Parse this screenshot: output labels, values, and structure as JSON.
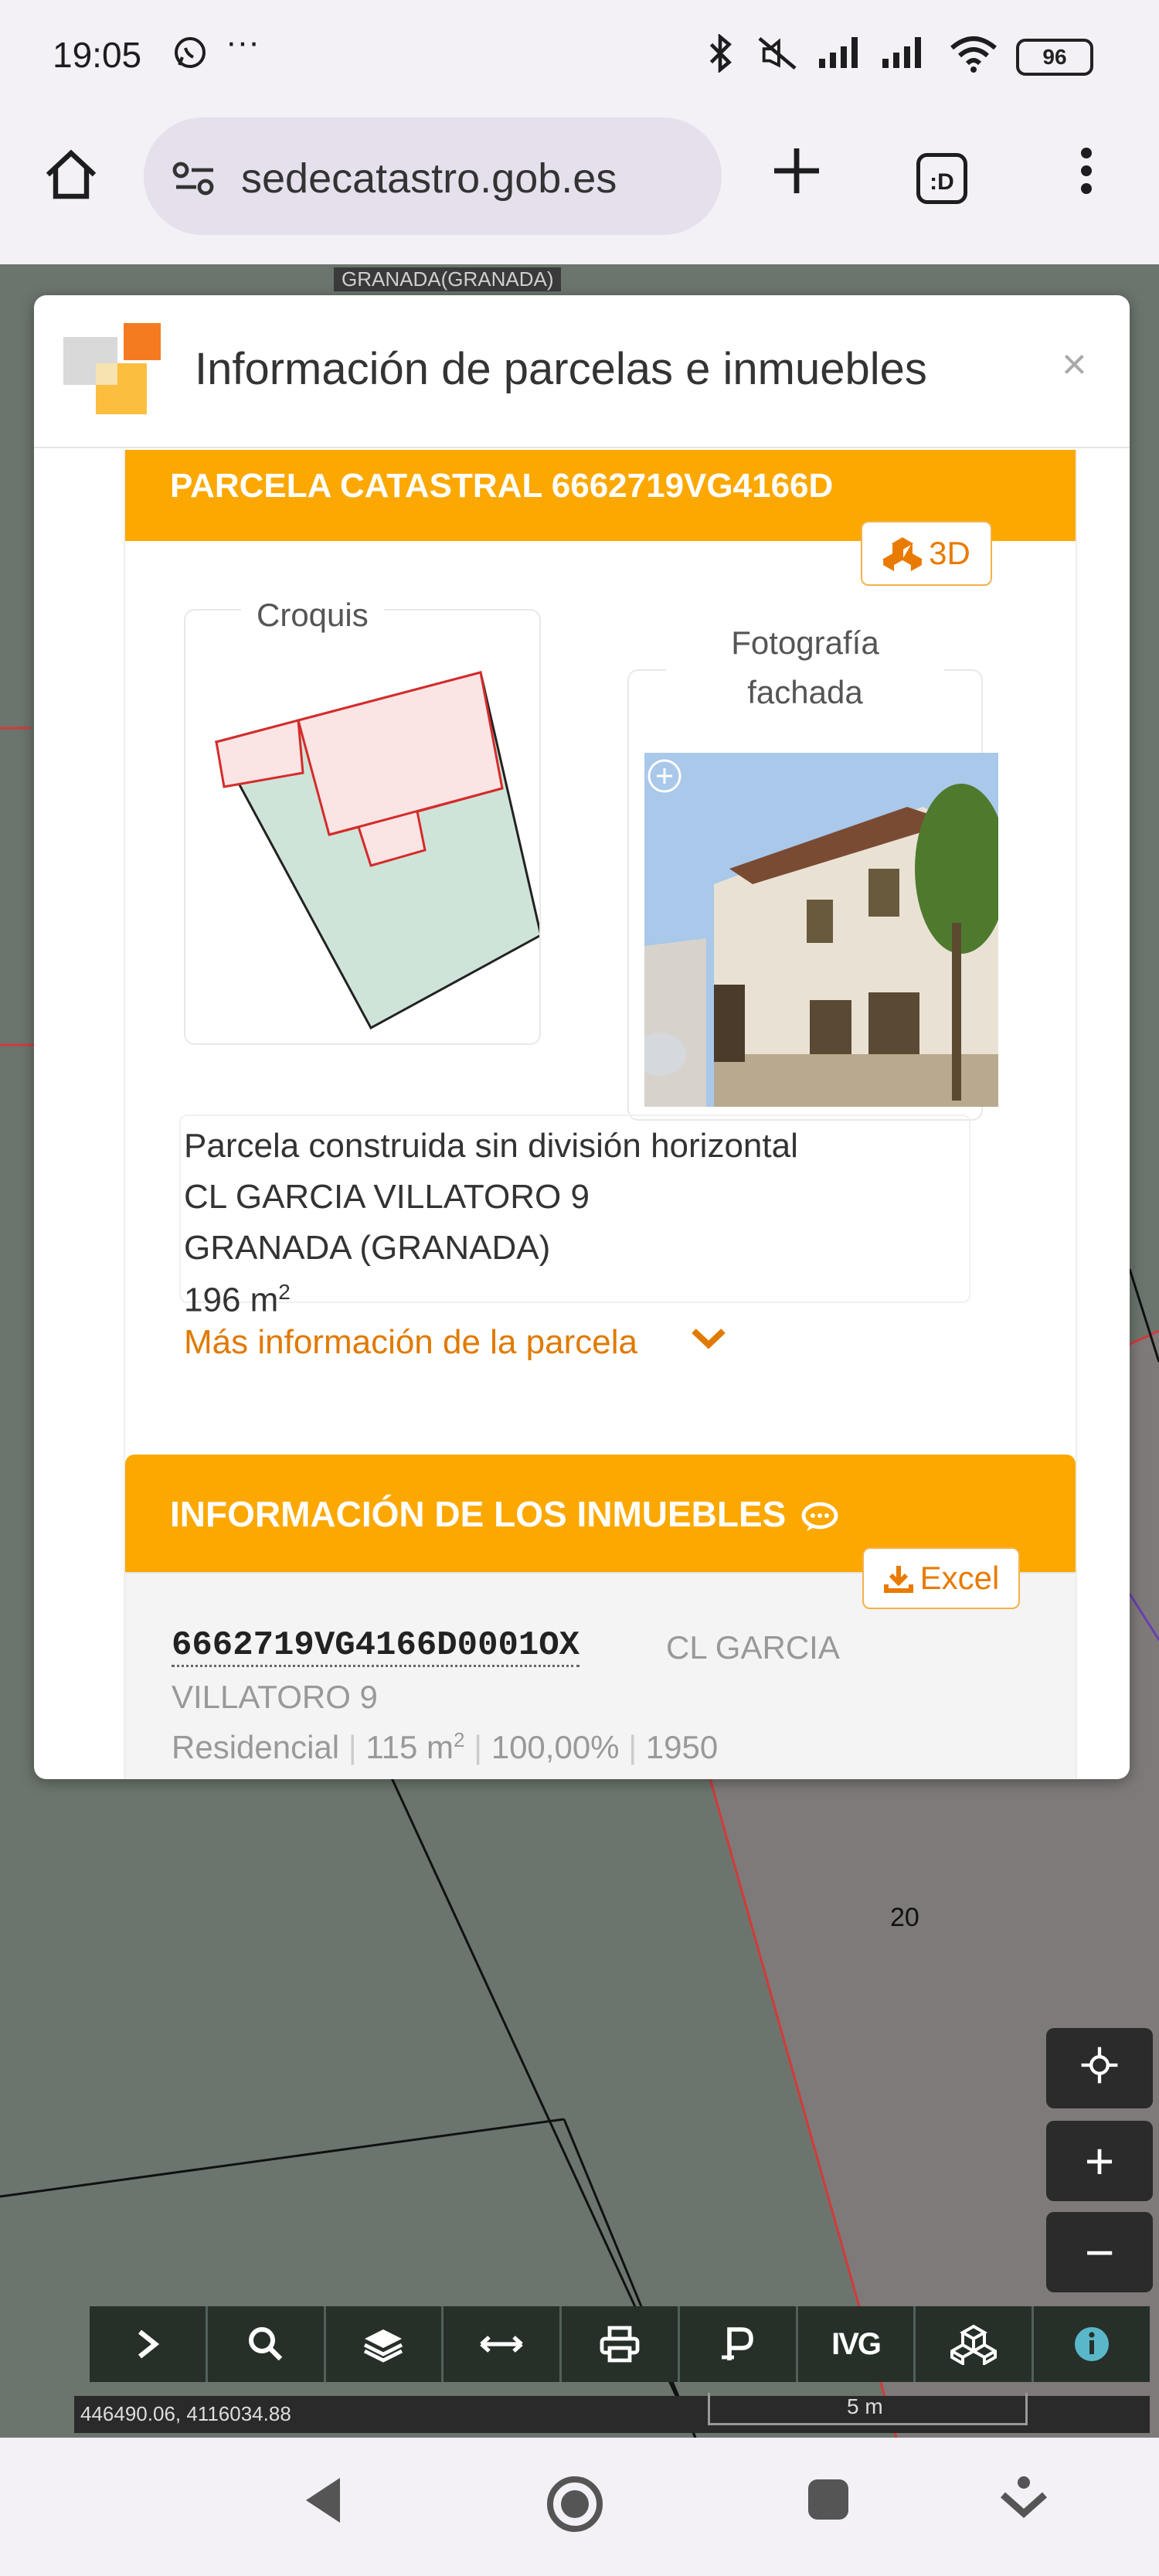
{
  "status_bar": {
    "time": "19:05",
    "icons": [
      "whatsapp-icon",
      "more-icon",
      "bluetooth-icon",
      "mute-icon",
      "signal-icon",
      "signal-icon",
      "wifi-icon"
    ],
    "battery": "96"
  },
  "browser": {
    "url": "sedecatastro.gob.es",
    "tabs_count": ":D"
  },
  "map": {
    "top_label": "GRANADA(GRANADA)",
    "parcel_number": "20",
    "coordinates": "446490.06, 4116034.88",
    "scale_label": "5 m",
    "toolbar": {
      "ivg_label": "IVG"
    }
  },
  "modal": {
    "title": "Información de parcelas e inmuebles",
    "close": "×",
    "parcela": {
      "header": "PARCELA CATASTRAL 6662719VG4166D",
      "btn_3d": "3D",
      "croquis_label": "Croquis",
      "foto_label_1": "Fotografía",
      "foto_label_2": "fachada",
      "type": "Parcela construida sin división horizontal",
      "address": "CL GARCIA VILLATORO 9",
      "city": "GRANADA (GRANADA)",
      "area_value": "196 m",
      "area_unit_sup": "2",
      "more_info": "Más información de la parcela"
    },
    "inmuebles": {
      "header": "INFORMACIÓN DE LOS INMUEBLES",
      "excel_btn": "Excel",
      "items": [
        {
          "ref": "6662719VG4166D0001OX",
          "address_1": "CL GARCIA",
          "address_2": "VILLATORO 9",
          "use": "Residencial",
          "area": "115 m",
          "area_sup": "2",
          "share": "100,00%",
          "year": "1950"
        }
      ]
    }
  }
}
